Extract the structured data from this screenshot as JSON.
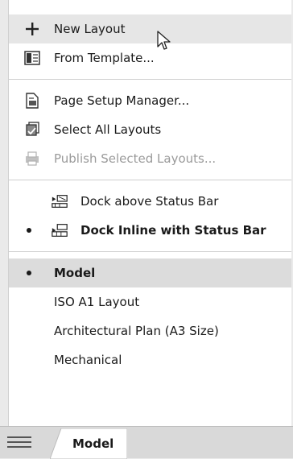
{
  "menu": {
    "items": [
      {
        "label": "New Layout",
        "icon": "plus-icon"
      },
      {
        "label": "From Template...",
        "icon": "template-icon"
      },
      {
        "label": "Page Setup Manager...",
        "icon": "page-setup-icon"
      },
      {
        "label": "Select All Layouts",
        "icon": "select-layouts-icon"
      },
      {
        "label": "Publish Selected Layouts...",
        "icon": "publish-icon",
        "disabled": true
      }
    ],
    "dock": [
      {
        "label": "Dock above Status Bar",
        "icon": "dock-above-icon"
      },
      {
        "label": "Dock Inline with Status Bar",
        "icon": "dock-inline-icon",
        "checked": true
      }
    ],
    "layouts": [
      {
        "label": "Model",
        "checked": true
      },
      {
        "label": "ISO A1 Layout"
      },
      {
        "label": "Architectural Plan (A3 Size)"
      },
      {
        "label": "Mechanical"
      }
    ]
  },
  "statusbar": {
    "menu_icon": "hamburger-icon",
    "active_tab": "Model"
  }
}
